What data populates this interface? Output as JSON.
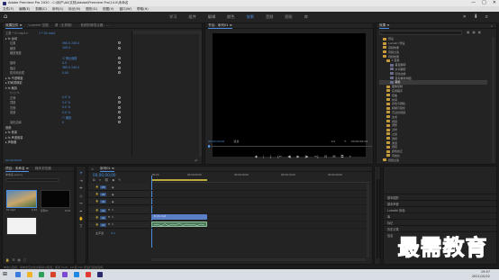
{
  "app": {
    "title": "Adobe Premiere Pro 2020 - C:\\用户\\Ali\\文档\\Adobe\\Premiere Pro\\14.0\\未命名",
    "window_controls": [
      "—",
      "□",
      "✕"
    ]
  },
  "menu": [
    "文件(F)",
    "编辑(E)",
    "剪辑(C)",
    "序列(S)",
    "标记(M)",
    "图形(G)",
    "视图(V)",
    "窗口(W)",
    "帮助(H)"
  ],
  "workspace": {
    "tabs": [
      "学习",
      "组件",
      "编辑",
      "颜色",
      "效果",
      "音频",
      "图形",
      "库"
    ],
    "active": "效果",
    "right_icons": [
      "»",
      "⬇",
      "⌕"
    ]
  },
  "effect_controls": {
    "tabs": [
      "效果控件 ≡",
      "Lumetri 范围",
      "源（无剪辑）",
      "音频剪辑混合器：…"
    ],
    "active": "效果控件 ≡",
    "rows": [
      {
        "name": "主要 * 01.mp4 ▾",
        "value": "1 * 01.mp4",
        "kind": "header"
      },
      {
        "name": "▸ fx  运动",
        "value": "",
        "kind": "section"
      },
      {
        "name": "位置",
        "value": "360.0  240.0",
        "kind": "prop"
      },
      {
        "name": "缩放",
        "value": "100.0",
        "kind": "prop"
      },
      {
        "name": "缩放宽度",
        "value": "",
        "kind": "prop"
      },
      {
        "name": "",
        "value": "☑ 等比缩放",
        "kind": "prop"
      },
      {
        "name": "旋转",
        "value": "0.0",
        "kind": "prop"
      },
      {
        "name": "锚点",
        "value": "360.0  240.0",
        "kind": "prop"
      },
      {
        "name": "防闪烁滤镜",
        "value": "0.00",
        "kind": "prop"
      },
      {
        "name": "▸ fx  不透明度",
        "value": "",
        "kind": "section"
      },
      {
        "name": "▸ 时间重映射",
        "value": "",
        "kind": "section"
      },
      {
        "name": "▾ fx  裁剪",
        "value": "",
        "kind": "section"
      },
      {
        "name": "○ □ ✎",
        "value": "",
        "kind": "prop"
      },
      {
        "name": "左侧",
        "value": "0.0 %",
        "kind": "prop"
      },
      {
        "name": "顶部",
        "value": "0.0 %",
        "kind": "prop"
      },
      {
        "name": "右侧",
        "value": "0.0 %",
        "kind": "prop"
      },
      {
        "name": "底部",
        "value": "0.0 %",
        "kind": "prop"
      },
      {
        "name": "",
        "value": "☐ 缩放",
        "kind": "prop"
      },
      {
        "name": "羽化边缘",
        "value": "0",
        "kind": "prop"
      },
      {
        "name": "音频",
        "value": "",
        "kind": "section"
      },
      {
        "name": "▸ fx  音量",
        "value": "",
        "kind": "section"
      },
      {
        "name": "▸ fx  声道音量",
        "value": "",
        "kind": "section"
      },
      {
        "name": "▸ 声像器",
        "value": "",
        "kind": "section"
      }
    ],
    "timecode": "00;00;00;00"
  },
  "program_monitor": {
    "title": "节目：序列01 ≡",
    "timecode_left": "00;00;00;00",
    "fit": "适合",
    "quality": "1/2",
    "timecode_right": "00;00;06;24",
    "controls": [
      "◆",
      "|",
      "}",
      "{←",
      "◀|",
      "▶",
      "|▶",
      "→}",
      "⊡",
      "⊟",
      "⧉",
      "+"
    ]
  },
  "effects_panel": {
    "tabs": [
      "效果 ≡",
      "»"
    ],
    "search_placeholder": "",
    "tree": [
      {
        "label": "预设",
        "depth": 1,
        "icon": "folder"
      },
      {
        "label": "Lumetri 预设",
        "depth": 1,
        "icon": "folder"
      },
      {
        "label": "音频效果",
        "depth": 1,
        "icon": "folder"
      },
      {
        "label": "音频过渡",
        "depth": 1,
        "icon": "folder"
      },
      {
        "label": "视频效果",
        "depth": 1,
        "icon": "folder"
      },
      {
        "label": "▾ 变换",
        "depth": 2,
        "icon": "folder"
      },
      {
        "label": "垂直翻转",
        "depth": 3,
        "icon": "fx"
      },
      {
        "label": "水平翻转",
        "depth": 3,
        "icon": "fx"
      },
      {
        "label": "羽化边缘",
        "depth": 3,
        "icon": "fx"
      },
      {
        "label": "自动重新构图",
        "depth": 3,
        "icon": "fx"
      },
      {
        "label": "裁剪",
        "depth": 3,
        "icon": "fx",
        "selected": true
      },
      {
        "label": "图像控制",
        "depth": 2,
        "icon": "folder"
      },
      {
        "label": "实用程序",
        "depth": 2,
        "icon": "folder"
      },
      {
        "label": "扭曲",
        "depth": 2,
        "icon": "folder"
      },
      {
        "label": "时间",
        "depth": 2,
        "icon": "folder"
      },
      {
        "label": "杂色与颗粒",
        "depth": 2,
        "icon": "folder"
      },
      {
        "label": "模糊与锐化",
        "depth": 2,
        "icon": "folder"
      },
      {
        "label": "沉浸式视频",
        "depth": 2,
        "icon": "folder"
      },
      {
        "label": "生成",
        "depth": 2,
        "icon": "folder"
      },
      {
        "label": "视频",
        "depth": 2,
        "icon": "folder"
      },
      {
        "label": "调整",
        "depth": 2,
        "icon": "folder"
      },
      {
        "label": "过时",
        "depth": 2,
        "icon": "folder"
      },
      {
        "label": "过渡",
        "depth": 2,
        "icon": "folder"
      },
      {
        "label": "透视",
        "depth": 2,
        "icon": "folder"
      },
      {
        "label": "通道",
        "depth": 2,
        "icon": "folder"
      },
      {
        "label": "键控",
        "depth": 2,
        "icon": "folder"
      },
      {
        "label": "颜色校正",
        "depth": 2,
        "icon": "folder"
      },
      {
        "label": "风格化",
        "depth": 2,
        "icon": "folder"
      },
      {
        "label": "视频过渡",
        "depth": 1,
        "icon": "folder"
      }
    ]
  },
  "side_panels": [
    "基本图形",
    "基本声音",
    "Lumetri 颜色",
    "库",
    "标记",
    "历史记录",
    "信息"
  ],
  "project": {
    "tabs": [
      "项目：未命名 ≡",
      "媒体浏览器"
    ],
    "file": "未命名.prproj",
    "items": [
      {
        "name": "01.mp4",
        "duration": "6;24"
      },
      {
        "name": "序列01",
        "duration": "6;24"
      },
      {
        "name": "",
        "duration": ""
      }
    ]
  },
  "timeline": {
    "title": "序列01 ≡",
    "timecode": "00;00;00;00",
    "ruler": [
      ":00;00",
      "00;00;05;00",
      "00;00;10;00",
      "00;00;15;00",
      "00;00;20;00"
    ],
    "tracks": [
      {
        "id": "V3",
        "type": "video"
      },
      {
        "id": "V2",
        "type": "video"
      },
      {
        "id": "V1",
        "type": "video"
      },
      {
        "id": "A1",
        "type": "audio"
      },
      {
        "id": "A2",
        "type": "audio"
      },
      {
        "id": "A3",
        "type": "audio"
      }
    ],
    "master": "主声道",
    "master_value": "0.0",
    "clips": [
      {
        "label": "fx 01.mp4",
        "track": "V1"
      },
      {
        "label": "",
        "track": "A1"
      }
    ]
  },
  "watermark": "最需教育",
  "status_text": "单击以选择，或单击空白处并拖动以框选。使用 Shift、Alt 和 Ctrl 键进行其他选择。",
  "taskbar": {
    "time": "19:57",
    "date": "2021/10/22",
    "icon_colors": [
      "#3b7ddd",
      "#f0b429",
      "#2e9e5b",
      "#d9432b",
      "#7d4bd1",
      "#1e88e5",
      "#e53935",
      "#2a2a6e"
    ]
  },
  "colors": {
    "accent": "#4c8fe0",
    "clip_video": "#5b7fc7",
    "clip_audio": "#4a7a5a",
    "watermark": "#1a2f9e"
  }
}
